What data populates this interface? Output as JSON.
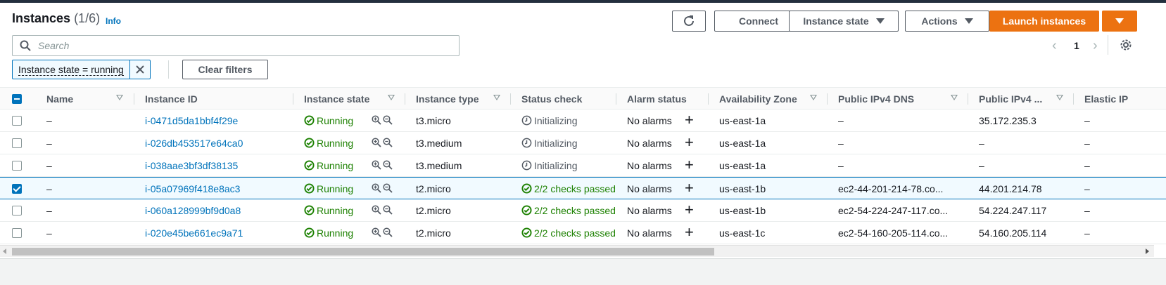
{
  "header": {
    "title": "Instances",
    "count": "(1/6)",
    "info": "Info"
  },
  "toolbar": {
    "connect": "Connect",
    "instance_state": "Instance state",
    "actions": "Actions",
    "launch": "Launch instances"
  },
  "search": {
    "placeholder": "Search"
  },
  "pagination": {
    "page": "1"
  },
  "filters": {
    "chip": "Instance state = running",
    "clear": "Clear filters"
  },
  "columns": {
    "name": "Name",
    "instance_id": "Instance ID",
    "instance_state": "Instance state",
    "instance_type": "Instance type",
    "status_check": "Status check",
    "alarm_status": "Alarm status",
    "availability_zone": "Availability Zone",
    "public_dns": "Public IPv4 DNS",
    "public_ip": "Public IPv4 ...",
    "elastic_ip": "Elastic IP"
  },
  "rows": [
    {
      "name": "–",
      "id": "i-0471d5da1bbf4f29e",
      "state": "Running",
      "type": "t3.micro",
      "status": "Initializing",
      "alarm": "No alarms",
      "az": "us-east-1a",
      "dns": "–",
      "ip": "35.172.235.3",
      "eip": "–",
      "selected": false
    },
    {
      "name": "–",
      "id": "i-026db453517e64ca0",
      "state": "Running",
      "type": "t3.medium",
      "status": "Initializing",
      "alarm": "No alarms",
      "az": "us-east-1a",
      "dns": "–",
      "ip": "–",
      "eip": "–",
      "selected": false
    },
    {
      "name": "–",
      "id": "i-038aae3bf3df38135",
      "state": "Running",
      "type": "t3.medium",
      "status": "Initializing",
      "alarm": "No alarms",
      "az": "us-east-1a",
      "dns": "–",
      "ip": "–",
      "eip": "–",
      "selected": false
    },
    {
      "name": "–",
      "id": "i-05a07969f418e8ac3",
      "state": "Running",
      "type": "t2.micro",
      "status": "2/2 checks passed",
      "alarm": "No alarms",
      "az": "us-east-1b",
      "dns": "ec2-44-201-214-78.co...",
      "ip": "44.201.214.78",
      "eip": "–",
      "selected": true
    },
    {
      "name": "–",
      "id": "i-060a128999bf9d0a8",
      "state": "Running",
      "type": "t2.micro",
      "status": "2/2 checks passed",
      "alarm": "No alarms",
      "az": "us-east-1b",
      "dns": "ec2-54-224-247-117.co...",
      "ip": "54.224.247.117",
      "eip": "–",
      "selected": false
    },
    {
      "name": "–",
      "id": "i-020e45be661ec9a71",
      "state": "Running",
      "type": "t2.micro",
      "status": "2/2 checks passed",
      "alarm": "No alarms",
      "az": "us-east-1c",
      "dns": "ec2-54-160-205-114.co...",
      "ip": "54.160.205.114",
      "eip": "–",
      "selected": false
    }
  ],
  "colors": {
    "primary": "#ec7211",
    "link": "#0073bb",
    "success": "#1d8102",
    "text": "#16191f"
  }
}
